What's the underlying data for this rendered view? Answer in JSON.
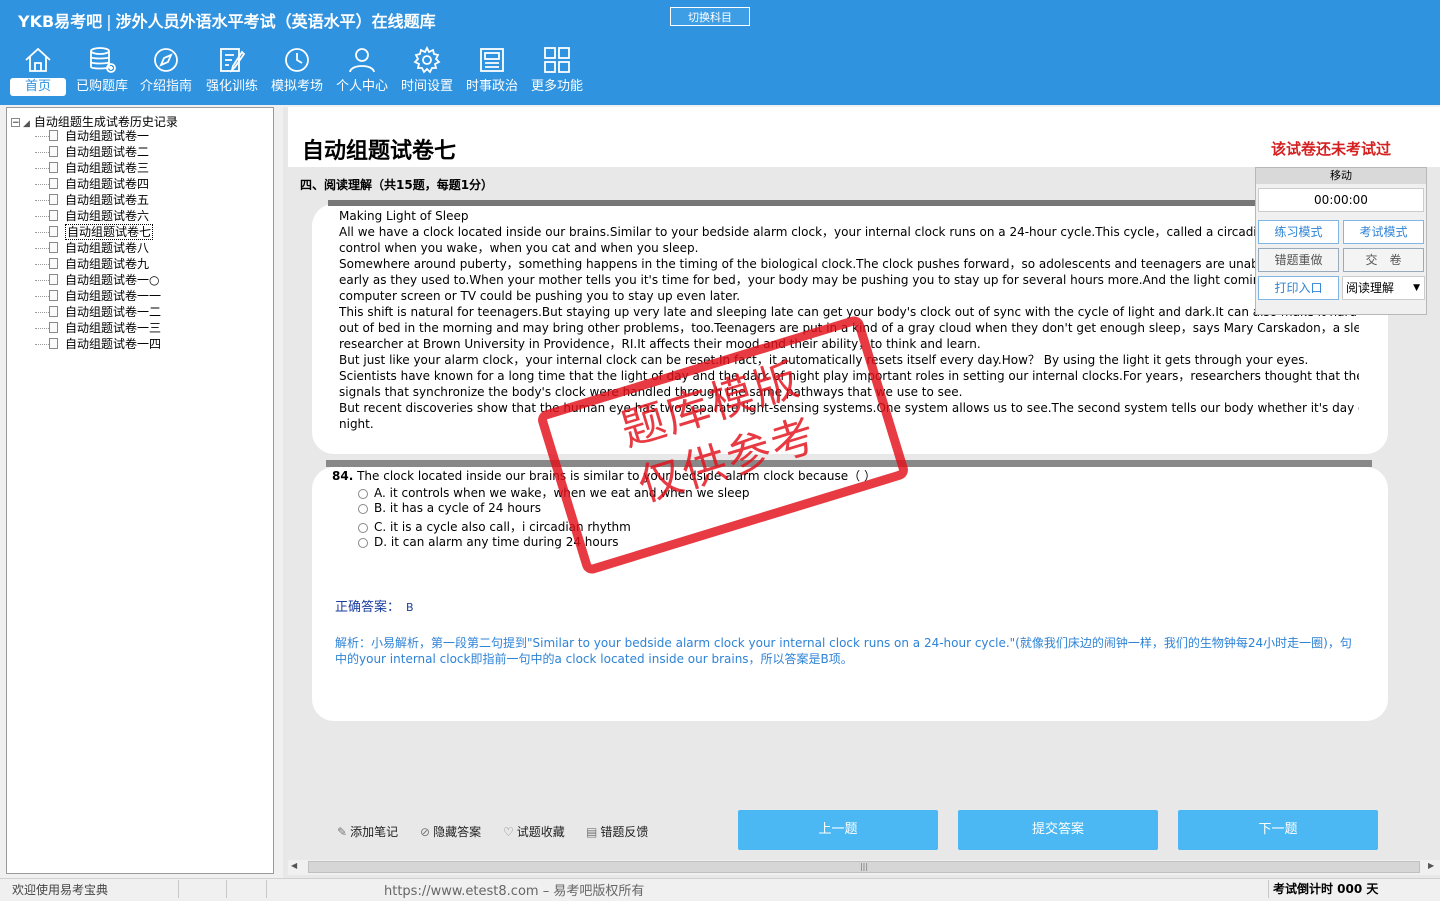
{
  "app": {
    "brand": "YKB易考吧",
    "title": "涉外人员外语水平考试（英语水平）在线题库",
    "switch_subject": "切换科目"
  },
  "nav": {
    "items": [
      {
        "label": "首页",
        "icon": "home-icon"
      },
      {
        "label": "已购题库",
        "icon": "database-icon"
      },
      {
        "label": "介绍指南",
        "icon": "compass-icon"
      },
      {
        "label": "强化训练",
        "icon": "edit-icon"
      },
      {
        "label": "模拟考场",
        "icon": "clock-icon"
      },
      {
        "label": "个人中心",
        "icon": "user-icon"
      },
      {
        "label": "时间设置",
        "icon": "gear-icon"
      },
      {
        "label": "时事政治",
        "icon": "news-icon"
      },
      {
        "label": "更多功能",
        "icon": "grid-icon"
      }
    ]
  },
  "tree": {
    "root": "自动组题生成试卷历史记录",
    "items": [
      "自动组题试卷一",
      "自动组题试卷二",
      "自动组题试卷三",
      "自动组题试卷四",
      "自动组题试卷五",
      "自动组题试卷六",
      "自动组题试卷七",
      "自动组题试卷八",
      "自动组题试卷九",
      "自动组题试卷一○",
      "自动组题试卷一一",
      "自动组题试卷一二",
      "自动组题试卷一三",
      "自动组题试卷一四"
    ],
    "selected": "自动组题试卷七"
  },
  "paper": {
    "title": "自动组题试卷七",
    "status": "该试卷还未考试过",
    "section": "四、阅读理解（共15题，每题1分）"
  },
  "passage": {
    "lines": [
      "Making Light of Sleep",
      "All we have a clock located inside our brains.Similar to your bedside alarm clock，your internal clock runs on a 24-hour cycle.This cycle，called a circadian rhythm，tells your body",
      "control when you wake，when you cat and when you sleep.",
      "Somewhere around puberty，something happens in the timing of the biological clock.The clock pushes forward，so adolescents and teenagers are unable to fall asleep as",
      "early as they used to.When your mother tells you it's time for bed，your body may be pushing you to stay up for several hours more.And the light coming from your",
      "computer screen or TV could be pushing you to stay up even later.",
      "This shift is natural for teenagers.But staying up very late and sleeping late can get your body's clock out of sync with the cycle of light and dark.It can also make it hard to get",
      "out of bed in the morning and may bring other problems，too.Teenagers are put in a kind of a gray cloud when they don't get enough sleep，says Mary Carskadon，a sleep",
      "researcher at Brown University in Providence，RI.It affects their mood and their ability，to think and learn.",
      "But just like your alarm clock，your internal clock can be reset.In fact，it automatically resets itself every day.How？ By using the light it gets through your eyes.",
      "Scientists have known for a long time that the light of day and the dark of night play important roles in setting our internal clocks.For years，researchers thought that the",
      "signals that synchronize the body's clock were handled through the same pathways that we use to see.",
      "But recent discoveries show that the human eye has two separate light-sensing systems.One system allows us to see.The second system tells our body whether it's day or",
      "night."
    ]
  },
  "question": {
    "number": "84.",
    "stem": "The clock located inside our brains is similar to your bedside alarm clock because（ ）",
    "options": [
      {
        "key": "A.",
        "text": "it controls when we wake，when we eat and when we sleep"
      },
      {
        "key": "B.",
        "text": "it has a cycle of 24 hours"
      },
      {
        "key": "C.",
        "text": "it is a cycle also call，i circadian rhythm"
      },
      {
        "key": "D.",
        "text": "it can alarm any time during 24 hours"
      }
    ],
    "answer_label": "正确答案：",
    "answer_value": "B",
    "explanation": "解析：小易解析，第一段第二句提到\"Similar to your bedside alarm clock your internal clock runs on a 24-hour cycle.\"(就像我们床边的闹钟一样，我们的生物钟每24小时走一圈)，句中的your internal clock即指前一句中的a clock located inside our brains，所以答案是B项。"
  },
  "timer_panel": {
    "move": "移动",
    "time": "00:00:00",
    "practice_mode": "练习模式",
    "exam_mode": "考试模式",
    "redo_wrong": "错题重做",
    "submit_paper": "交　卷",
    "print": "打印入口",
    "type_select": "阅读理解"
  },
  "toolbar": {
    "add_note": "添加笔记",
    "hide_answer": "隐藏答案",
    "favorite": "试题收藏",
    "feedback": "错题反馈",
    "prev": "上一题",
    "submit": "提交答案",
    "next": "下一题"
  },
  "status": {
    "welcome": "欢迎使用易考宝典",
    "url": "https://www.etest8.com – 易考吧版权所有",
    "countdown": "考试倒计时 000 天"
  },
  "watermark": {
    "line1": "题库模版",
    "line2": "仅供参考"
  },
  "colors": {
    "header": "#2f93e0",
    "accent_button": "#4cb8f3",
    "status_red": "#d42020",
    "stamp_red": "#e3101a",
    "answer_blue": "#1a3ea0",
    "explain_blue": "#2e83d6"
  }
}
